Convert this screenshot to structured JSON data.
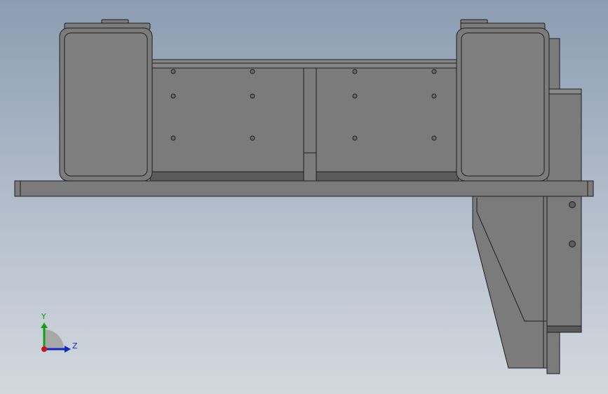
{
  "view": {
    "background_top": "#8c9db2",
    "background_bottom": "#d3d8de"
  },
  "model": {
    "body_color": "#7b7b7b",
    "edge_color": "#1e1e1e",
    "shadow_color": "#5a5a5a",
    "highlight_color": "#9a9a9a"
  },
  "triad": {
    "y_label": "Y",
    "z_label": "Z",
    "y_color": "#14a014",
    "z_color": "#1428c8",
    "x_color": "#c81414"
  }
}
